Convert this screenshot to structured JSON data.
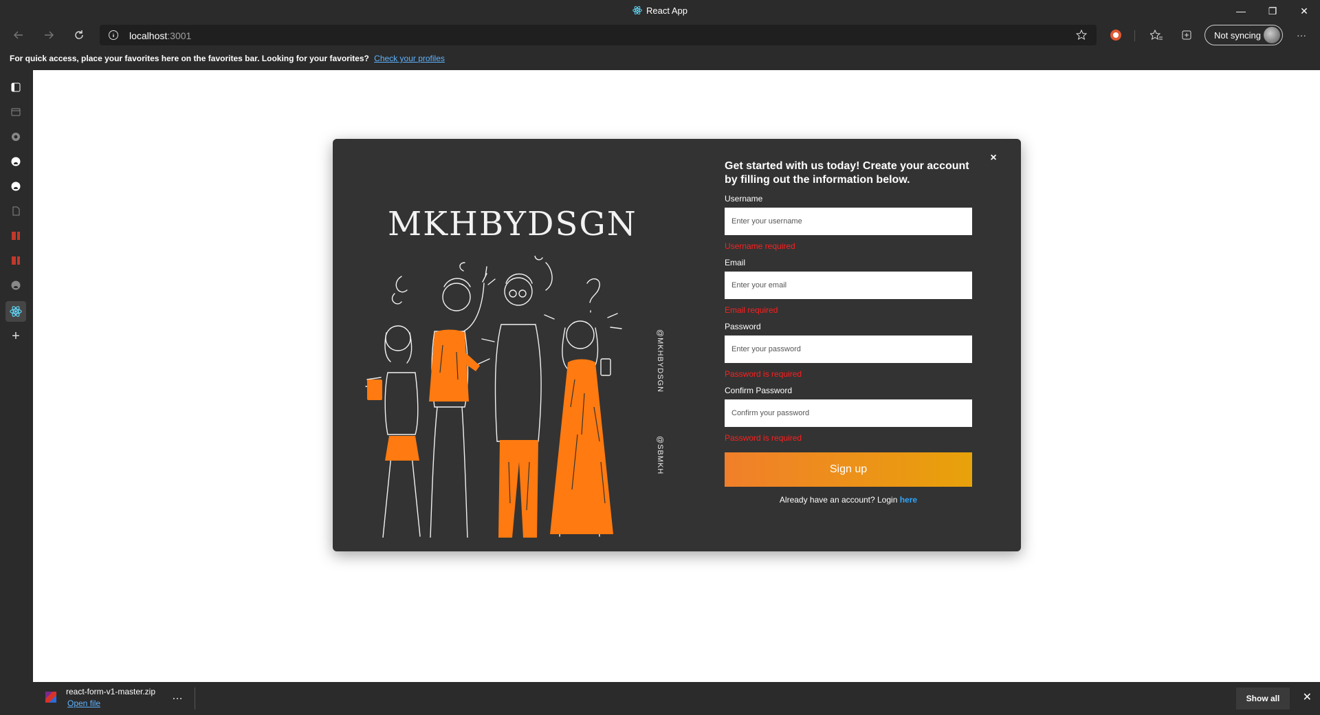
{
  "window": {
    "title": "React App"
  },
  "address_bar": {
    "host": "localhost",
    "port": ":3001"
  },
  "profile": {
    "sync_label": "Not syncing"
  },
  "favorites_bar": {
    "message": "For quick access, place your favorites here on the favorites bar. Looking for your favorites?",
    "link": "Check your profiles"
  },
  "card": {
    "brand": "MKHBYDSGN",
    "handle_1": "@MKHBYDSGN",
    "handle_2": "@SBMKH",
    "headline": "Get started with us today! Create your account by filling out the information below.",
    "close_label": "×",
    "fields": {
      "username": {
        "label": "Username",
        "placeholder": "Enter your username",
        "error": "Username required"
      },
      "email": {
        "label": "Email",
        "placeholder": "Enter your email",
        "error": "Email required"
      },
      "password": {
        "label": "Password",
        "placeholder": "Enter your password",
        "error": "Password is required"
      },
      "confirm": {
        "label": "Confirm Password",
        "placeholder": "Confirm your password",
        "error": "Password is required"
      }
    },
    "submit_label": "Sign up",
    "login_prompt": "Already have an account? Login",
    "login_link": "here"
  },
  "downloads": {
    "file_name": "react-form-v1-master.zip",
    "open_label": "Open file",
    "more_label": "…",
    "show_all_label": "Show all"
  },
  "colors": {
    "accent_orange": "#f17f2a",
    "accent_yellow": "#e8a20a",
    "error_red": "#ff1f1f",
    "link_blue": "#2ea6ff"
  }
}
